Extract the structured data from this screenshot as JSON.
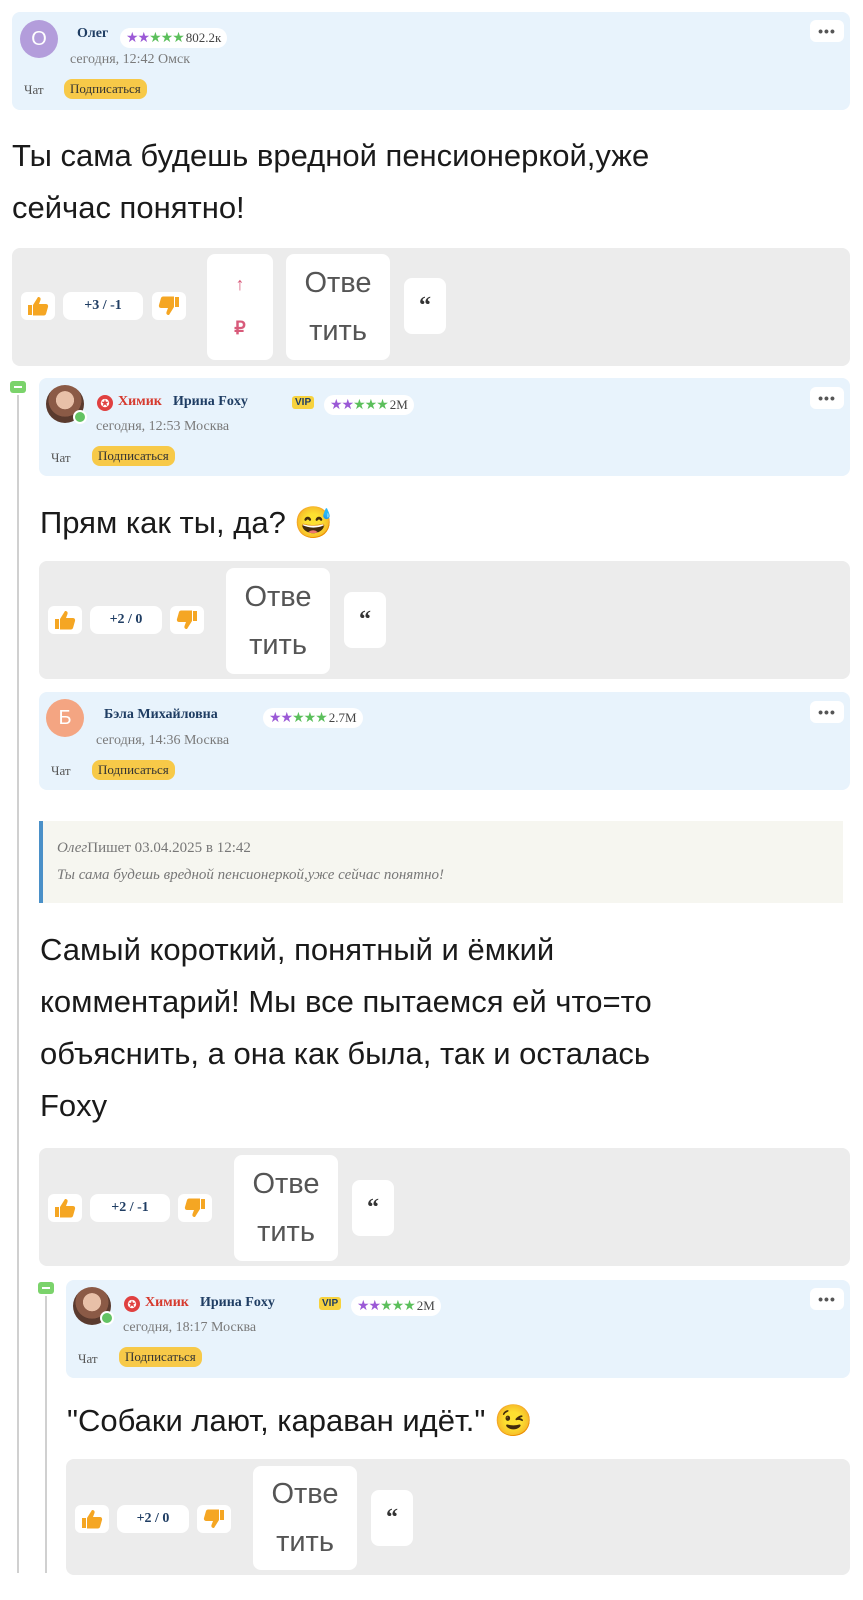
{
  "comments": [
    {
      "author": "Олег",
      "avatar_letter": "О",
      "avatar_color": "#b39ddb",
      "stars": "★★★★★",
      "rating": "802.2к",
      "meta": "сегодня, 12:42  Омск",
      "chat": "Чат",
      "subscribe": "Подписаться",
      "text_line1": "Ты сама будешь вредной пенсионеркой,уже",
      "text_line2": "сейчас понятно!",
      "score": "+3 / -1",
      "reply_line1": "Отве",
      "reply_line2": "тить",
      "quote_icon": "“",
      "donate_arrow": "↑",
      "donate_rub": "₽"
    },
    {
      "badge": "Химик",
      "author": "Ирина Foxy",
      "vip": "VIP",
      "stars": "★★★★★",
      "rating": "2M",
      "meta": "сегодня, 12:53  Москва",
      "chat": "Чат",
      "subscribe": "Подписаться",
      "text": "Прям как ты, да? 😅",
      "score": "+2 / 0",
      "reply_line1": "Отве",
      "reply_line2": "тить",
      "quote_icon": "“"
    },
    {
      "author": "Бэла Михайловна",
      "avatar_letter": "Б",
      "avatar_color": "#f4a582",
      "stars": "★★★★★",
      "rating": "2.7M",
      "meta": "сегодня, 14:36  Москва",
      "chat": "Чат",
      "subscribe": "Подписаться",
      "quote_author": "Олег",
      "quote_meta": "Пишет 03.04.2025 в 12:42",
      "quote_text": "Ты сама будешь вредной пенсионеркой,уже сейчас понятно!",
      "text_line1": "Самый короткий, понятный и ёмкий",
      "text_line2": "комментарий! Мы все пытаемся ей что=то",
      "text_line3": "объяснить, а она как была, так и осталась",
      "text_line4": "Foxy",
      "score": "+2 / -1",
      "reply_line1": "Отве",
      "reply_line2": "тить",
      "quote_icon": "“"
    },
    {
      "badge": "Химик",
      "author": "Ирина Foxy",
      "vip": "VIP",
      "stars": "★★★★★",
      "rating": "2M",
      "meta": "сегодня, 18:17  Москва",
      "chat": "Чат",
      "subscribe": "Подписаться",
      "text": "\"Собаки лают, караван идёт.\" 😉",
      "score": "+2 / 0",
      "reply_line1": "Отве",
      "reply_line2": "тить",
      "quote_icon": "“"
    }
  ],
  "menu_icon": "•••",
  "colors": {
    "header_bg": "#e8f3fc",
    "actionbar_bg": "#ececec",
    "subscribe": "#f7c948",
    "thumb_up": "#f5a623",
    "thumb_down": "#f5a623",
    "star_purple": "#9b59d6",
    "star_green": "#5bbf5b",
    "badge_red": "#d63a2e"
  }
}
